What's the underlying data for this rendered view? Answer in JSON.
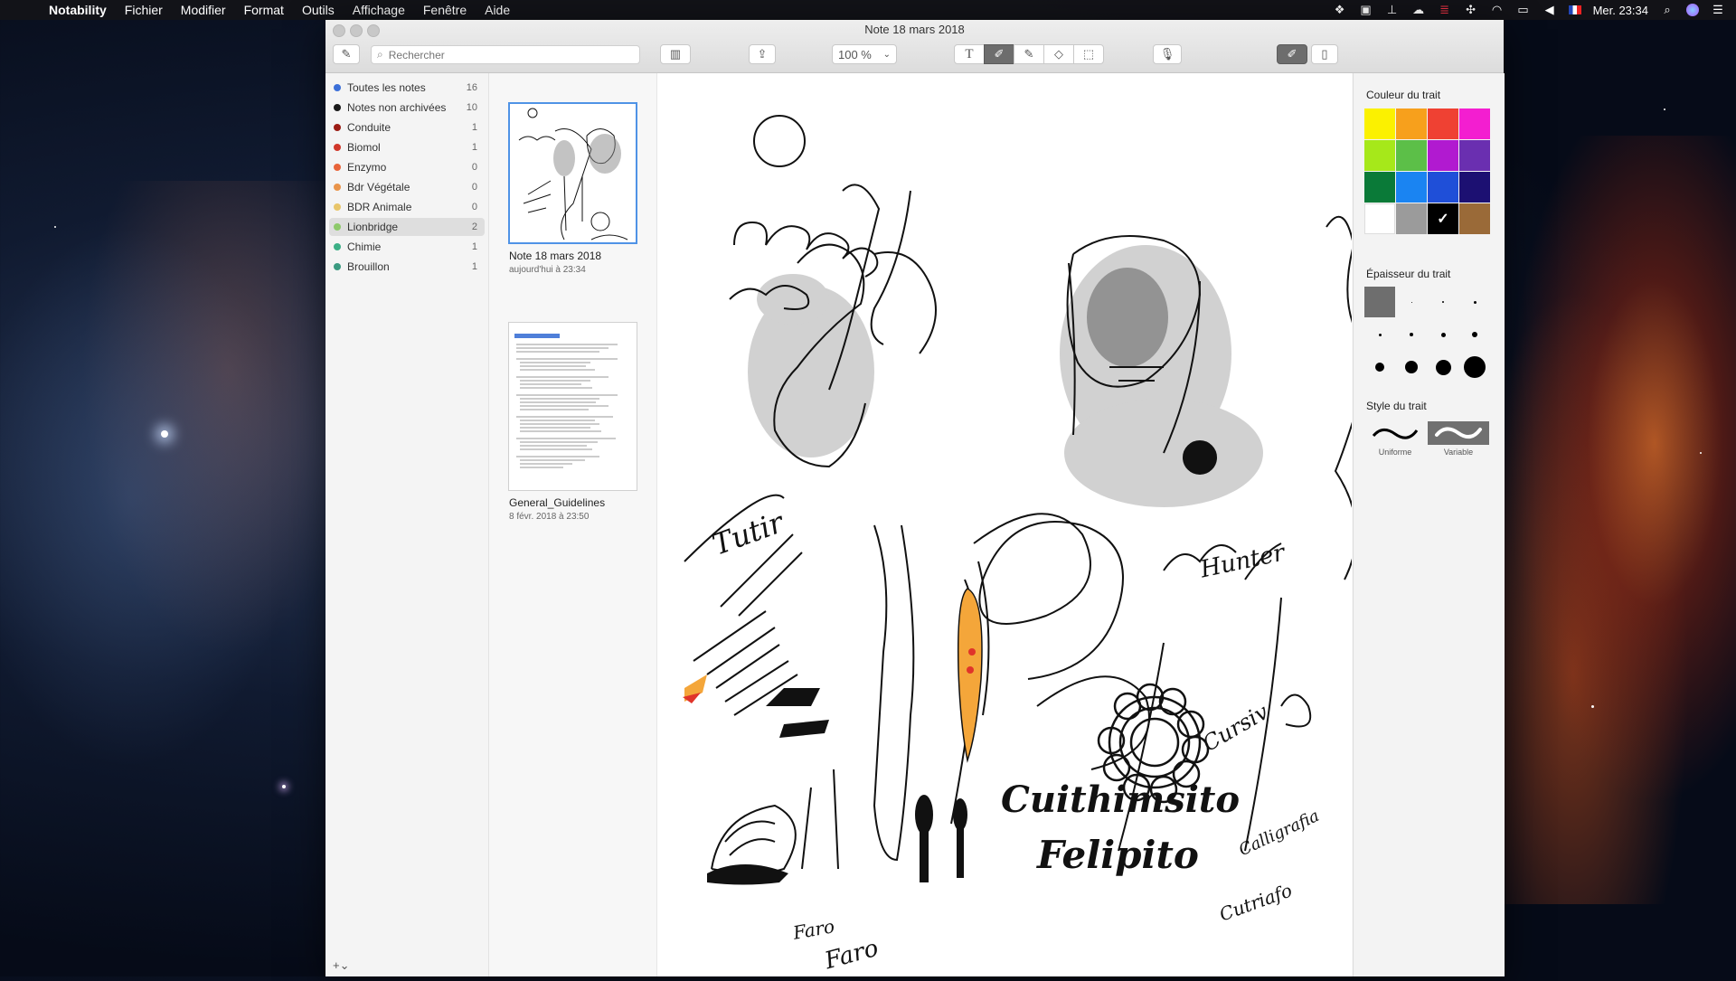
{
  "menubar": {
    "app_name": "Notability",
    "items": [
      "Fichier",
      "Modifier",
      "Format",
      "Outils",
      "Affichage",
      "Fenêtre",
      "Aide"
    ],
    "clock": "Mer. 23:34",
    "status_icons": [
      "dropbox-icon",
      "chat-icon",
      "pin-icon",
      "cloud-icon",
      "battery-bar-icon",
      "network-icon",
      "wifi-icon",
      "airplay-icon",
      "volume-icon",
      "flag-fr-icon",
      "search-icon",
      "siri-icon",
      "list-icon"
    ]
  },
  "window": {
    "title": "Note 18 mars 2018",
    "search_placeholder": "Rechercher",
    "zoom": "100 %"
  },
  "sidebar": {
    "categories": [
      {
        "label": "Toutes les notes",
        "count": "16",
        "color": "#3b6fd8"
      },
      {
        "label": "Notes non archivées",
        "count": "10",
        "color": "#1a1a1a"
      },
      {
        "label": "Conduite",
        "count": "1",
        "color": "#9b1c14"
      },
      {
        "label": "Biomol",
        "count": "1",
        "color": "#d0372a"
      },
      {
        "label": "Enzymo",
        "count": "0",
        "color": "#e8643a"
      },
      {
        "label": "Bdr Végétale",
        "count": "0",
        "color": "#e9944a"
      },
      {
        "label": "BDR Animale",
        "count": "0",
        "color": "#e8c56a"
      },
      {
        "label": "Lionbridge",
        "count": "2",
        "color": "#8dc96a"
      },
      {
        "label": "Chimie",
        "count": "1",
        "color": "#3caf86"
      },
      {
        "label": "Brouillon",
        "count": "1",
        "color": "#3a9a80"
      }
    ],
    "selected": "Lionbridge",
    "add_label": "+⌄"
  },
  "notes": [
    {
      "title": "Note 18 mars 2018",
      "date": "aujourd'hui à 23:34"
    },
    {
      "title": "General_Guidelines",
      "date": "8 févr. 2018 à 23:50"
    }
  ],
  "panel": {
    "color_heading": "Couleur du trait",
    "colors": [
      "#fbf100",
      "#f7a01c",
      "#ef4133",
      "#f31ed0",
      "#a6e81a",
      "#5cbf48",
      "#b11ad0",
      "#6a2fb0",
      "#0a7a38",
      "#1a84f2",
      "#1f4fd8",
      "#1c1072",
      "#ffffff",
      "#9b9b9b",
      "#000000",
      "#9a6a38"
    ],
    "selected_color": "#000000",
    "thickness_heading": "Épaisseur du trait",
    "style_heading": "Style du trait",
    "styles": [
      "Uniforme",
      "Variable"
    ],
    "selected_style": "Variable"
  },
  "canvas_text": {
    "signature_1": "Tutir",
    "signature_2": "Hunter",
    "signature_3": "Cuithimsito",
    "signature_4": "Felipito",
    "signature_5": "Faro",
    "signature_6": "Faro",
    "signature_7": "Calligrafia",
    "signature_8": "Cutriafo",
    "signature_9": "Cursiv"
  }
}
